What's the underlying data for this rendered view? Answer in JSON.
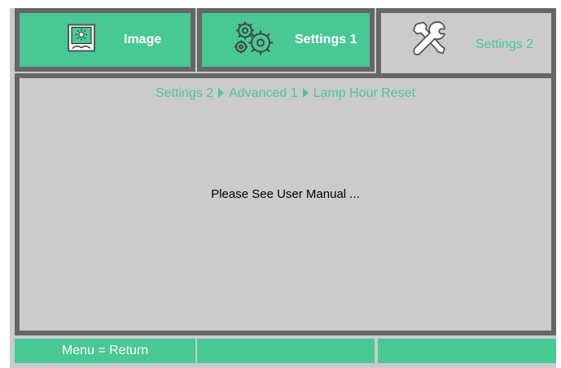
{
  "tabs": [
    {
      "label": "Image",
      "icon": "image-icon",
      "active": false
    },
    {
      "label": "Settings 1",
      "icon": "gears-icon",
      "active": false
    },
    {
      "label": "Settings 2",
      "icon": "wrench-hammer-icon",
      "active": true
    }
  ],
  "breadcrumb": {
    "items": [
      "Settings 2",
      "Advanced 1",
      "Lamp Hour Reset"
    ]
  },
  "message": "Please See User Manual ...",
  "footer": {
    "cells": [
      "Menu = Return",
      "",
      ""
    ]
  },
  "colors": {
    "accent": "#48c895",
    "panel_bg": "#cbcbcb",
    "border": "#666666"
  }
}
